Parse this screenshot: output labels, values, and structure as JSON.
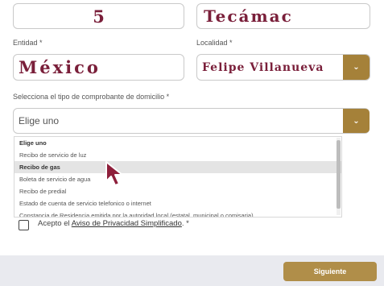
{
  "top_row": {
    "number_value": "5",
    "municipality_value": "Tecámac"
  },
  "entidad": {
    "label": "Entidad *",
    "value": "México"
  },
  "localidad": {
    "label": "Localidad *",
    "value": "Felipe Villanueva",
    "chevron_icon": "chevron-down-icon"
  },
  "comprobante": {
    "label": "Selecciona el tipo de comprobante de domicilio *",
    "selected": "Elige uno",
    "chevron_icon": "chevron-down-icon",
    "options": [
      "Elige uno",
      "Recibo de servicio de luz",
      "Recibo de gas",
      "Boleta de servicio de agua",
      "Recibo de predial",
      "Estado de cuenta de servicio telefonico o internet",
      "Constancia de Residencia emitida por la autoridad local (estatal, municipal o comisaria)"
    ],
    "hovered_option": "Recibo de gas"
  },
  "privacy": {
    "prefix": "Acepto el",
    "link": "Aviso de Privacidad Simplificado",
    "suffix": ". *",
    "checked": false
  },
  "actions": {
    "next_label": "Siguiente"
  },
  "colors": {
    "accent_gold": "#a58139",
    "value_maroon": "#7a1f3a"
  }
}
